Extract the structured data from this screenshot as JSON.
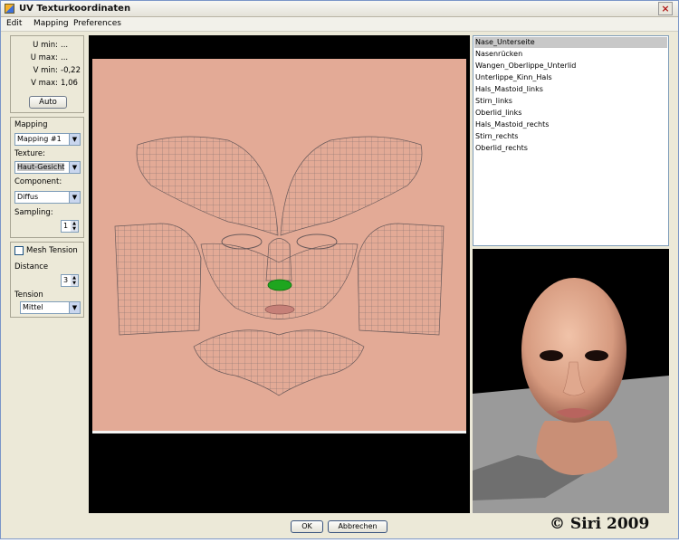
{
  "window": {
    "title": "UV Texturkoordinaten",
    "close_label": "×"
  },
  "menu": [
    "Edit",
    "Mapping",
    "Preferences"
  ],
  "coords": [
    {
      "label": "U min:",
      "value": "..."
    },
    {
      "label": "U max:",
      "value": "..."
    },
    {
      "label": "V min:",
      "value": "-0,22"
    },
    {
      "label": "V max:",
      "value": "1,06"
    }
  ],
  "auto_button": "Auto",
  "mapping_panel": {
    "mapping_label": "Mapping",
    "mapping_value": "Mapping #1",
    "texture_label": "Texture:",
    "texture_value": "Haut-Gesicht",
    "component_label": "Component:",
    "component_value": "Diffus",
    "sampling_label": "Sampling:",
    "sampling_value": "1"
  },
  "tension_panel": {
    "mesh_tension_label": "Mesh Tension",
    "mesh_tension_checked": false,
    "distance_label": "Distance",
    "distance_value": "3",
    "tension_label": "Tension",
    "tension_value": "Mittel"
  },
  "parts_list": [
    "Nase_Unterseite",
    "Nasenrücken",
    "Wangen_Oberlippe_Unterlid",
    "Unterlippe_Kinn_Hals",
    "Hals_Mastoid_links",
    "Stirn_links",
    "Oberlid_links",
    "Hals_Mastoid_rechts",
    "Stirn_rechts",
    "Oberlid_rechts"
  ],
  "selected_part_index": 0,
  "buttons": {
    "ok": "OK",
    "cancel": "Abbrechen"
  },
  "copyright": "© Siri 2009",
  "colors": {
    "texture_bg": "#e3aa96",
    "wire": "#7a6a6a",
    "selection_green": "#1fa51f",
    "viewport_bg": "#000000"
  }
}
